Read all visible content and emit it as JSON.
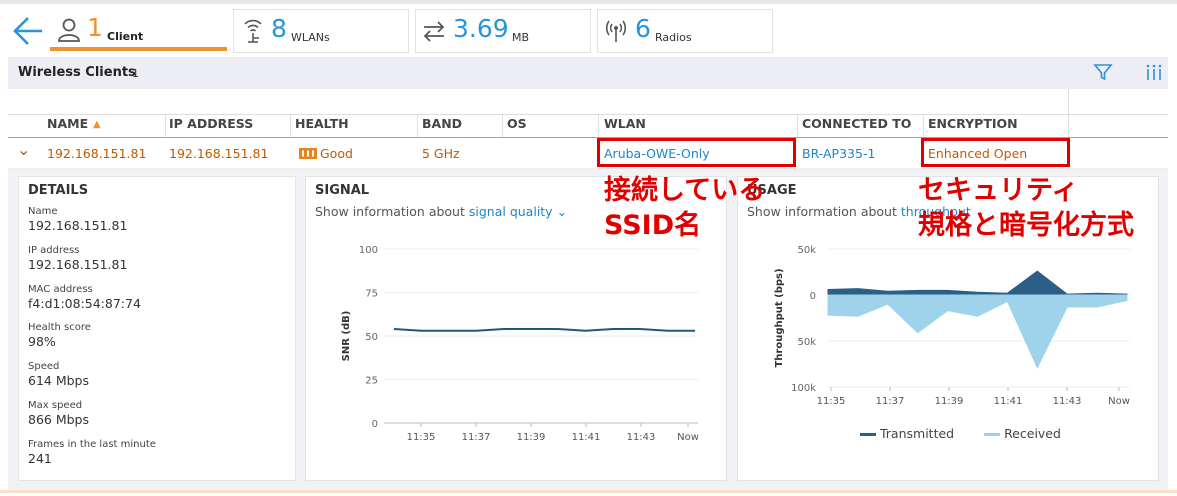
{
  "stats": {
    "client": {
      "value": "1",
      "label": "Client"
    },
    "wlans": {
      "value": "8",
      "label": "WLANs"
    },
    "traffic": {
      "value": "3.69",
      "label": "MB"
    },
    "radios": {
      "value": "6",
      "label": "Radios"
    }
  },
  "section": {
    "title": "Wireless Clients",
    "count": "1"
  },
  "columns": [
    "NAME",
    "IP ADDRESS",
    "HEALTH",
    "BAND",
    "OS",
    "WLAN",
    "CONNECTED TO",
    "ENCRYPTION"
  ],
  "sort_indicator": "▲",
  "row": {
    "expand": "⌄",
    "name": "192.168.151.81",
    "ip": "192.168.151.81",
    "health": "Good",
    "band": "5 GHz",
    "os": "",
    "wlan": "Aruba-OWE-Only",
    "connected_to": "BR-AP335-1",
    "encryption": "Enhanced Open"
  },
  "details": {
    "title": "DETAILS",
    "fields": [
      {
        "label": "Name",
        "value": "192.168.151.81"
      },
      {
        "label": "IP address",
        "value": "192.168.151.81"
      },
      {
        "label": "MAC address",
        "value": "f4:d1:08:54:87:74"
      },
      {
        "label": "Health score",
        "value": "98%"
      },
      {
        "label": "Speed",
        "value": "614 Mbps"
      },
      {
        "label": "Max speed",
        "value": "866 Mbps"
      },
      {
        "label": "Frames in the last minute",
        "value": "241"
      }
    ]
  },
  "signal": {
    "title": "SIGNAL",
    "show_label": "Show information about",
    "metric": "signal quality"
  },
  "usage": {
    "title": "USAGE",
    "show_label": "Show information about",
    "metric": "throughput"
  },
  "annotations": {
    "wlan_line1": "接続している",
    "wlan_line2": "SSID名",
    "enc_line1": "セキュリティ",
    "enc_line2": "規格と暗号化方式"
  },
  "chart_data": [
    {
      "type": "line",
      "ylabel": "SNR (dB)",
      "ylim": [
        0,
        100
      ],
      "yticks": [
        "100",
        "75",
        "50",
        "25",
        "0"
      ],
      "xticks": [
        "11:35",
        "11:37",
        "11:39",
        "11:41",
        "11:43",
        "Now"
      ],
      "series": [
        {
          "values": [
            54,
            53,
            53,
            53,
            54,
            54,
            54,
            53,
            54,
            54,
            53,
            53
          ]
        }
      ],
      "color": "#1f5a7a"
    },
    {
      "type": "area",
      "ylabel": "Throughput (bps)",
      "yticks": [
        "50k",
        "0",
        "50k",
        "100k"
      ],
      "ylim": [
        -100000,
        50000
      ],
      "xticks": [
        "11:35",
        "11:37",
        "11:39",
        "11:41",
        "11:43",
        "Now"
      ],
      "series": [
        {
          "name": "Transmitted",
          "color": "#2a5f86",
          "values": [
            6000,
            7000,
            4000,
            5000,
            5000,
            3000,
            2000,
            26000,
            1000,
            2000,
            1000
          ]
        },
        {
          "name": "Received",
          "color": "#9fd3ec",
          "values": [
            -22000,
            -23000,
            -10000,
            -41000,
            -17000,
            -23000,
            -7000,
            -79000,
            -13000,
            -13000,
            -6000
          ]
        }
      ]
    }
  ]
}
